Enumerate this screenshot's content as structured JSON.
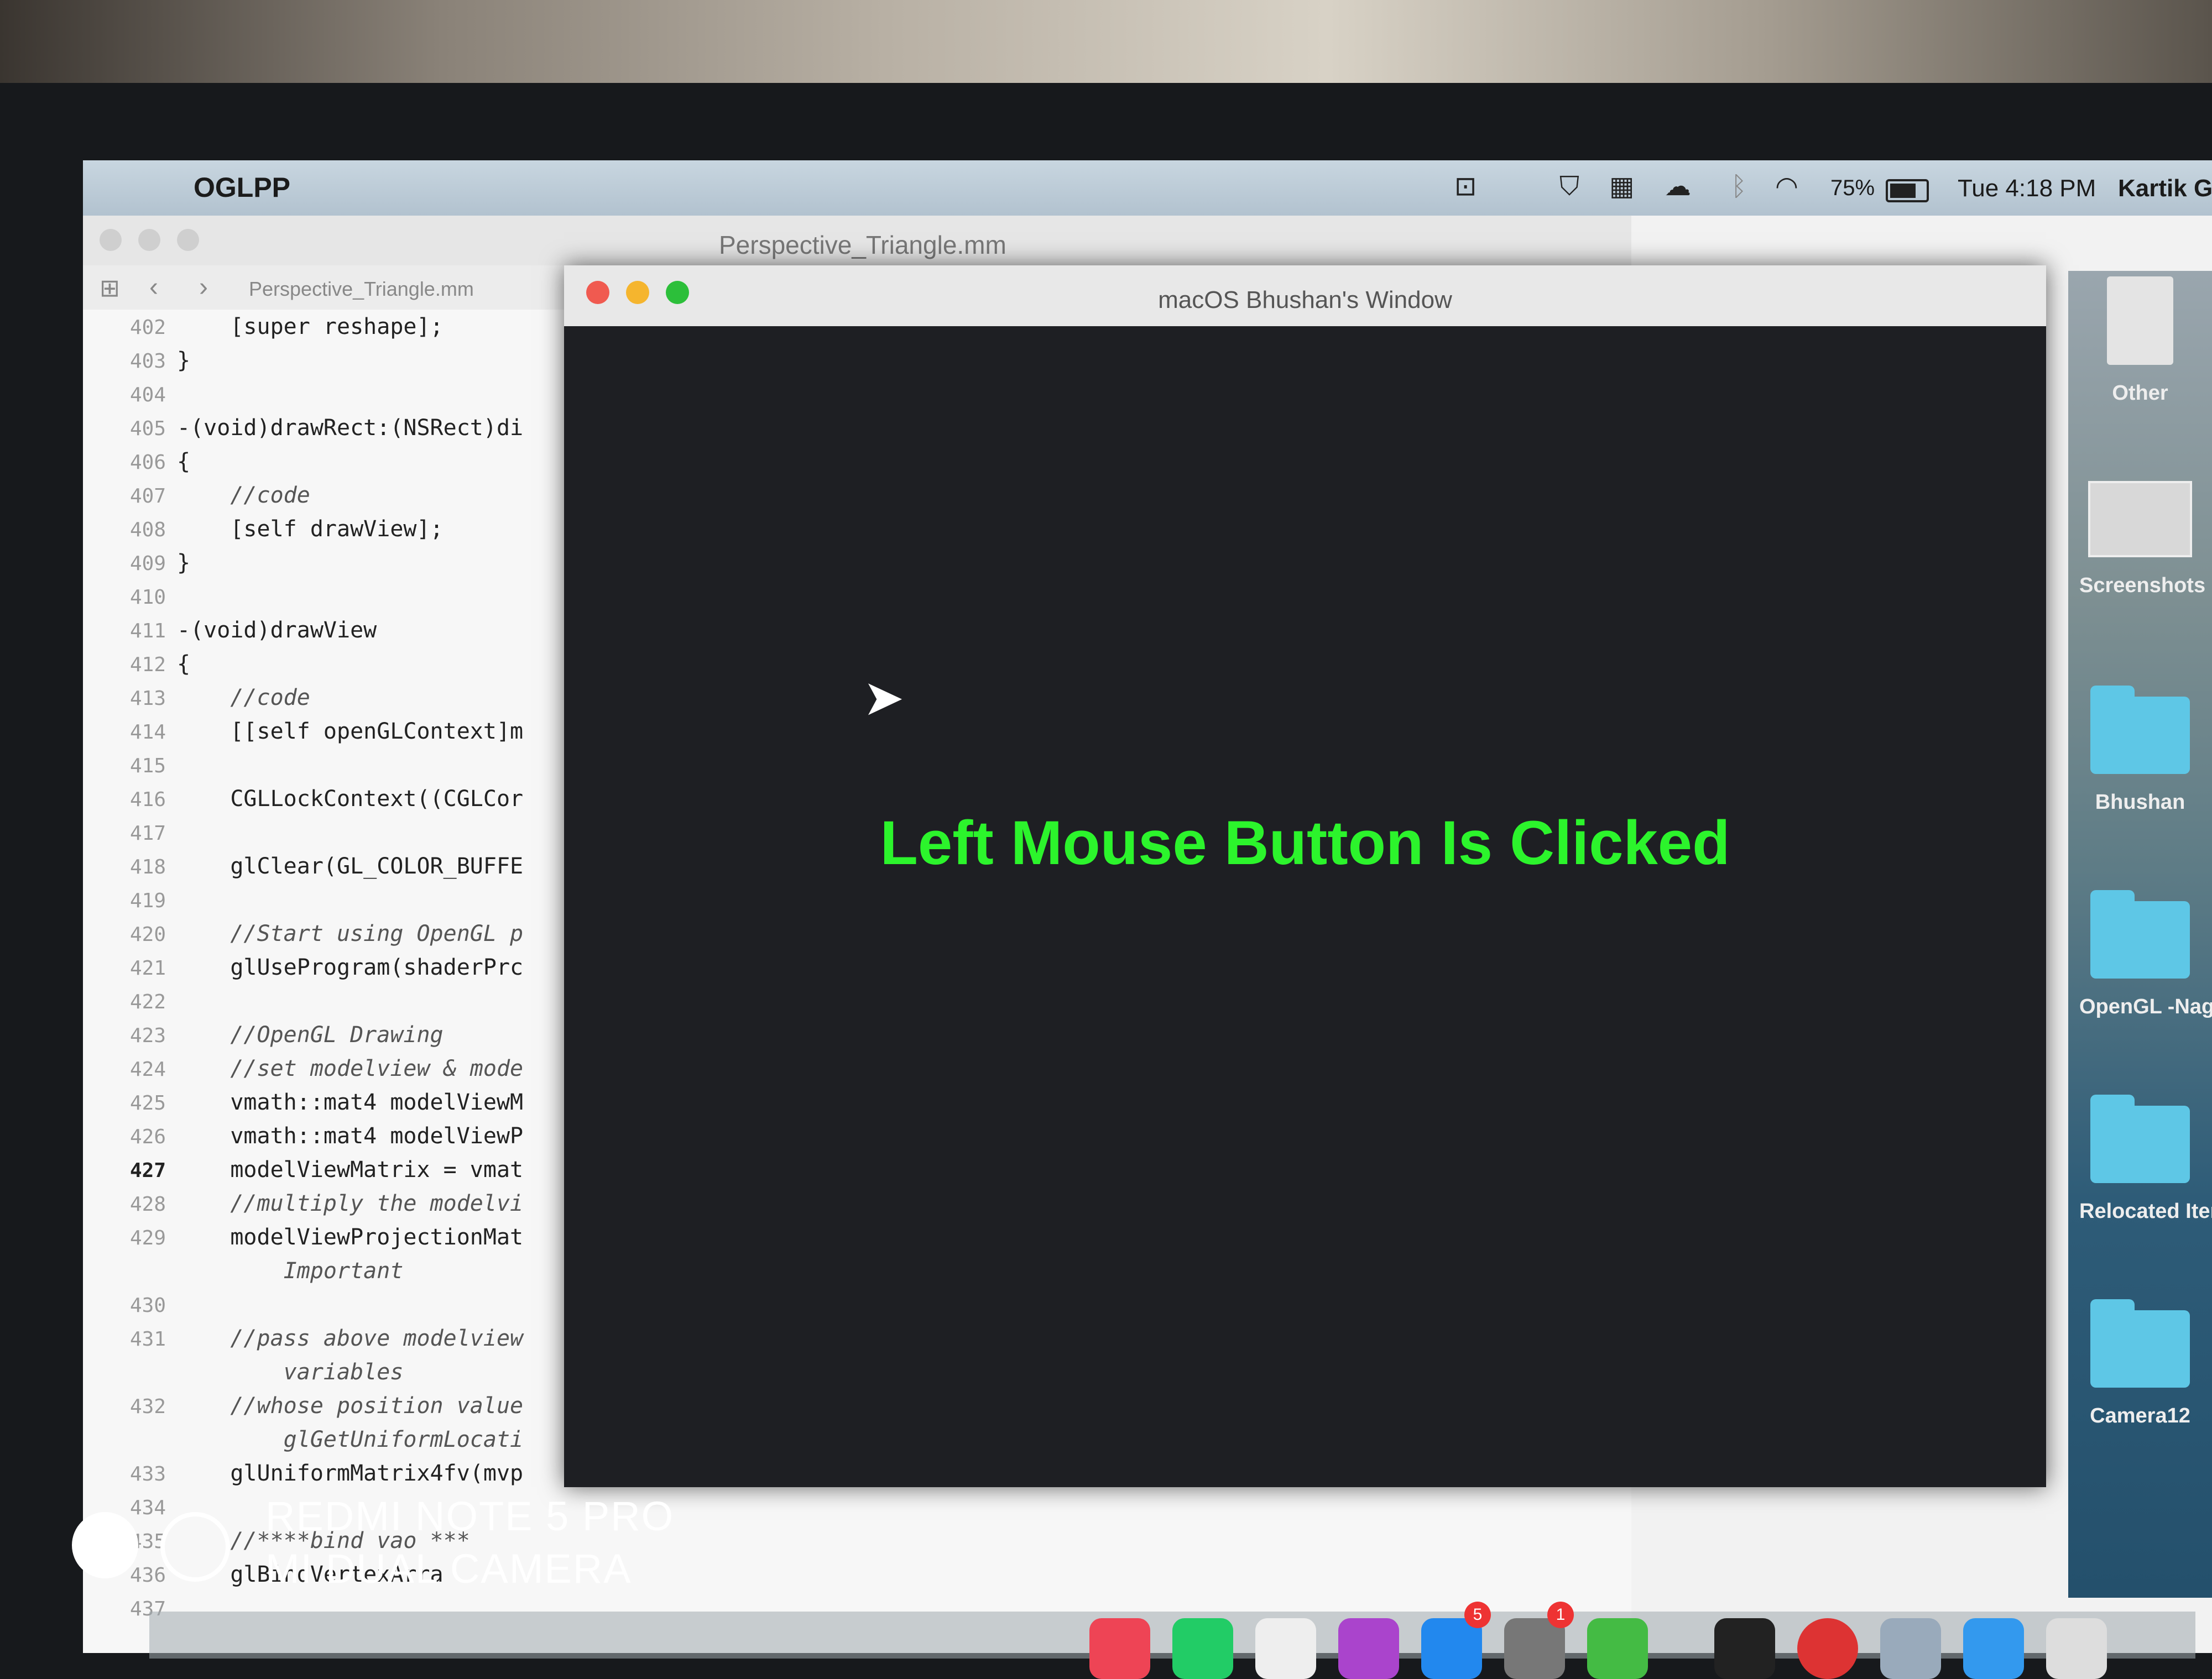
{
  "menubar": {
    "app_name": "OGLPP",
    "battery": "75%",
    "clock": "Tue 4:18 PM",
    "user": "Kartik Gl"
  },
  "xcode": {
    "title": "Perspective_Triangle.mm",
    "breadcrumb": "Perspective_Triangle.mm",
    "code_lines": [
      {
        "n": "402",
        "text": "    [super reshape];"
      },
      {
        "n": "403",
        "text": "}"
      },
      {
        "n": "404",
        "text": ""
      },
      {
        "n": "405",
        "text": "-(void)drawRect:(NSRect)di"
      },
      {
        "n": "406",
        "text": "{"
      },
      {
        "n": "407",
        "text": "    //code"
      },
      {
        "n": "408",
        "text": "    [self drawView];"
      },
      {
        "n": "409",
        "text": "}"
      },
      {
        "n": "410",
        "text": ""
      },
      {
        "n": "411",
        "text": "-(void)drawView"
      },
      {
        "n": "412",
        "text": "{"
      },
      {
        "n": "413",
        "text": "    //code"
      },
      {
        "n": "414",
        "text": "    [[self openGLContext]m"
      },
      {
        "n": "415",
        "text": ""
      },
      {
        "n": "416",
        "text": "    CGLLockContext((CGLCor"
      },
      {
        "n": "417",
        "text": ""
      },
      {
        "n": "418",
        "text": "    glClear(GL_COLOR_BUFFE"
      },
      {
        "n": "419",
        "text": ""
      },
      {
        "n": "420",
        "text": "    //Start using OpenGL p"
      },
      {
        "n": "421",
        "text": "    glUseProgram(shaderPrc"
      },
      {
        "n": "422",
        "text": ""
      },
      {
        "n": "423",
        "text": "    //OpenGL Drawing"
      },
      {
        "n": "424",
        "text": "    //set modelview & mode"
      },
      {
        "n": "425",
        "text": "    vmath::mat4 modelViewM"
      },
      {
        "n": "426",
        "text": "    vmath::mat4 modelViewP"
      },
      {
        "n": "427",
        "text": "    modelViewMatrix = vmat"
      },
      {
        "n": "428",
        "text": "    //multiply the modelvi"
      },
      {
        "n": "429",
        "text": "    modelViewProjectionMat"
      },
      {
        "n": "",
        "text": "        Important"
      },
      {
        "n": "430",
        "text": ""
      },
      {
        "n": "431",
        "text": "    //pass above modelview"
      },
      {
        "n": "",
        "text": "        variables"
      },
      {
        "n": "432",
        "text": "    //whose position value"
      },
      {
        "n": "",
        "text": "        glGetUniformLocati"
      },
      {
        "n": "433",
        "text": "    glUniformMatrix4fv(mvp"
      },
      {
        "n": "434",
        "text": ""
      },
      {
        "n": "435",
        "text": "    //****bind vao ***"
      },
      {
        "n": "436",
        "text": "    glBindVertexArra"
      },
      {
        "n": "437",
        "text": ""
      }
    ],
    "current_line": "427"
  },
  "gl_window": {
    "title": "macOS Bhushan's Window",
    "message": "Left Mouse Button Is Clicked",
    "message_color": "#2cf42c"
  },
  "desktop": {
    "items": [
      "Other",
      "Screenshots",
      "Bhushan",
      "OpenGL -Nages",
      "Relocated Item",
      "Camera12"
    ]
  },
  "watermark": {
    "line1": "REDMI NOTE 5 PRO",
    "line2": "MI DUAL CAMERA"
  },
  "dock": {
    "app_store_badge": "5",
    "system_prefs_badge": "1"
  }
}
